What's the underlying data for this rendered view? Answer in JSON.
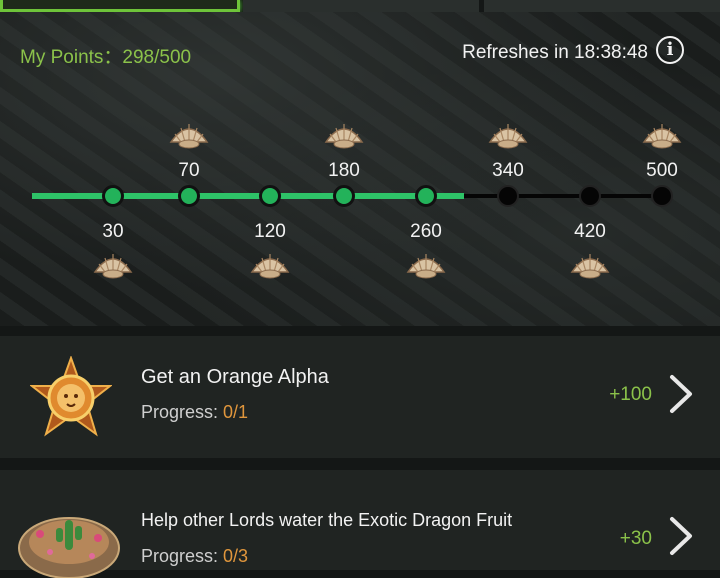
{
  "header": {
    "points_label": "My Points：298/500",
    "refresh_label": "Refreshes in 18:38:48",
    "info_icon": "i"
  },
  "progress": {
    "current": 298,
    "max": 500,
    "milestones": [
      {
        "value": 30,
        "label": "30",
        "reached": true
      },
      {
        "value": 70,
        "label": "70",
        "reached": true
      },
      {
        "value": 120,
        "label": "120",
        "reached": true
      },
      {
        "value": 180,
        "label": "180",
        "reached": true
      },
      {
        "value": 260,
        "label": "260",
        "reached": true
      },
      {
        "value": 340,
        "label": "340",
        "reached": false
      },
      {
        "value": 420,
        "label": "420",
        "reached": false
      },
      {
        "value": 500,
        "label": "500",
        "reached": false
      }
    ]
  },
  "tasks": [
    {
      "title": "Get an Orange Alpha",
      "progress_label": "Progress: ",
      "progress_value": "0/1",
      "reward": "+100",
      "icon": "orange-lion-badge-icon"
    },
    {
      "title": "Help other Lords water the Exotic Dragon Fruit",
      "progress_label": "Progress: ",
      "progress_value": "0/3",
      "reward": "+30",
      "icon": "cactus-island-icon"
    }
  ],
  "colors": {
    "accent_green": "#8bc24a",
    "track_green": "#2ec368",
    "progress_orange": "#e0963c"
  }
}
